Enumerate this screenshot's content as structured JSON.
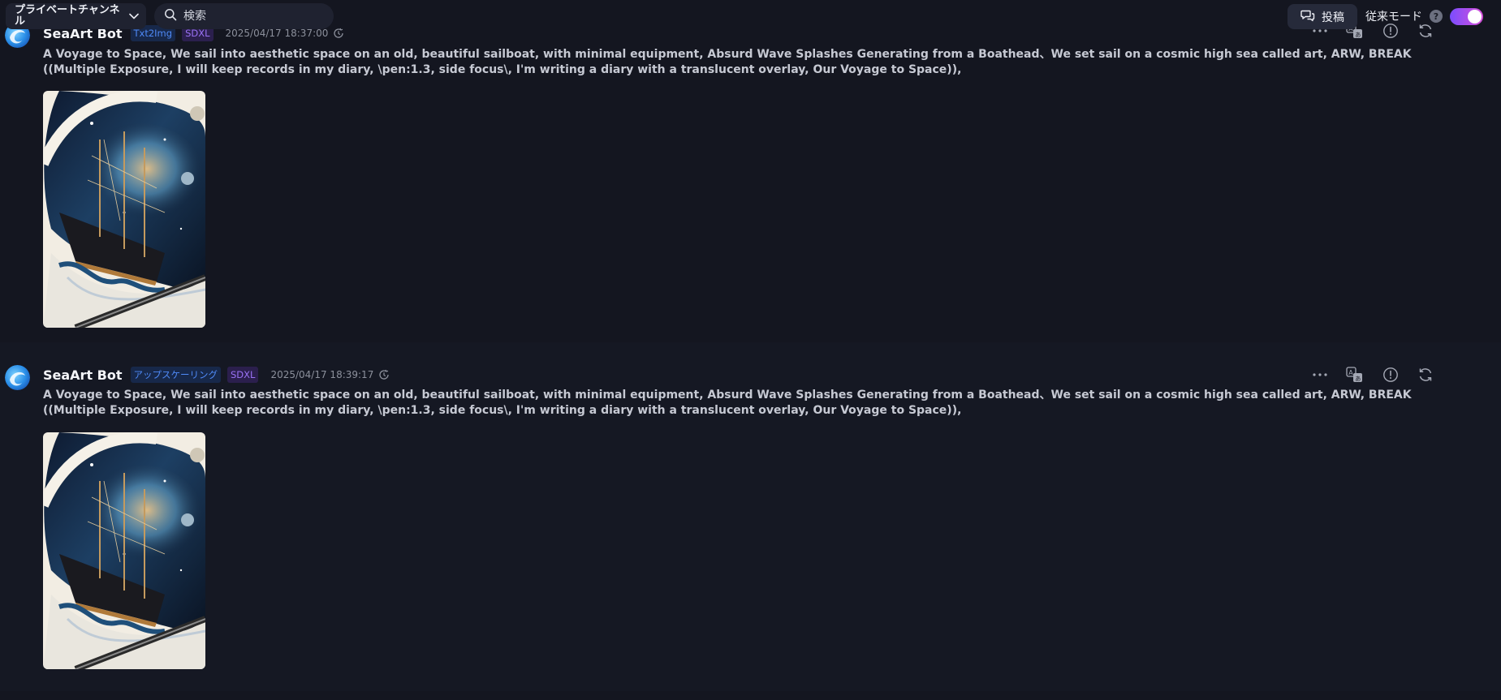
{
  "topbar": {
    "channel_name": "プライベートチャンネル",
    "search_placeholder": "検索",
    "search_value": "",
    "post_label": "投稿",
    "legacy_mode_label": "従来モード",
    "help_text": "?",
    "legacy_mode_enabled": true
  },
  "messages": [
    {
      "author": "SeaArt Bot",
      "tags": [
        "Txt2Img",
        "SDXL"
      ],
      "timestamp": "2025/04/17 18:37:00",
      "prompt": "A Voyage to Space, We sail into aesthetic space on an old, beautiful sailboat, with minimal equipment, Absurd Wave Splashes Generating from a Boathead、We set sail on a cosmic high sea called art, ARW, BREAK ((Multiple Exposure, I will keep records in my diary, \\pen:1.3, side focus\\, I'm writing a diary with a translucent overlay, Our Voyage to Space)),"
    },
    {
      "author": "SeaArt Bot",
      "tags": [
        "アップスケーリング",
        "SDXL"
      ],
      "timestamp": "2025/04/17 18:39:17",
      "prompt": "A Voyage to Space, We sail into aesthetic space on an old, beautiful sailboat, with minimal equipment, Absurd Wave Splashes Generating from a Boathead、We set sail on a cosmic high sea called art, ARW, BREAK ((Multiple Exposure, I will keep records in my diary, \\pen:1.3, side focus\\, I'm writing a diary with a translucent overlay, Our Voyage to Space)),"
    }
  ],
  "icons": {
    "channel_dropdown": "chevron-down-icon",
    "search": "search-icon",
    "post": "chat-bubbles-icon",
    "help": "question-icon",
    "timestamp": "clock-refresh-icon",
    "actions": [
      "more-icon",
      "translate-icon",
      "report-icon",
      "regenerate-icon"
    ]
  },
  "colors": {
    "background": "#141620",
    "tag_blue": "#4f8af7",
    "tag_purple": "#9a72f5",
    "toggle_start": "#7b4dff",
    "toggle_end": "#d64fd8"
  }
}
